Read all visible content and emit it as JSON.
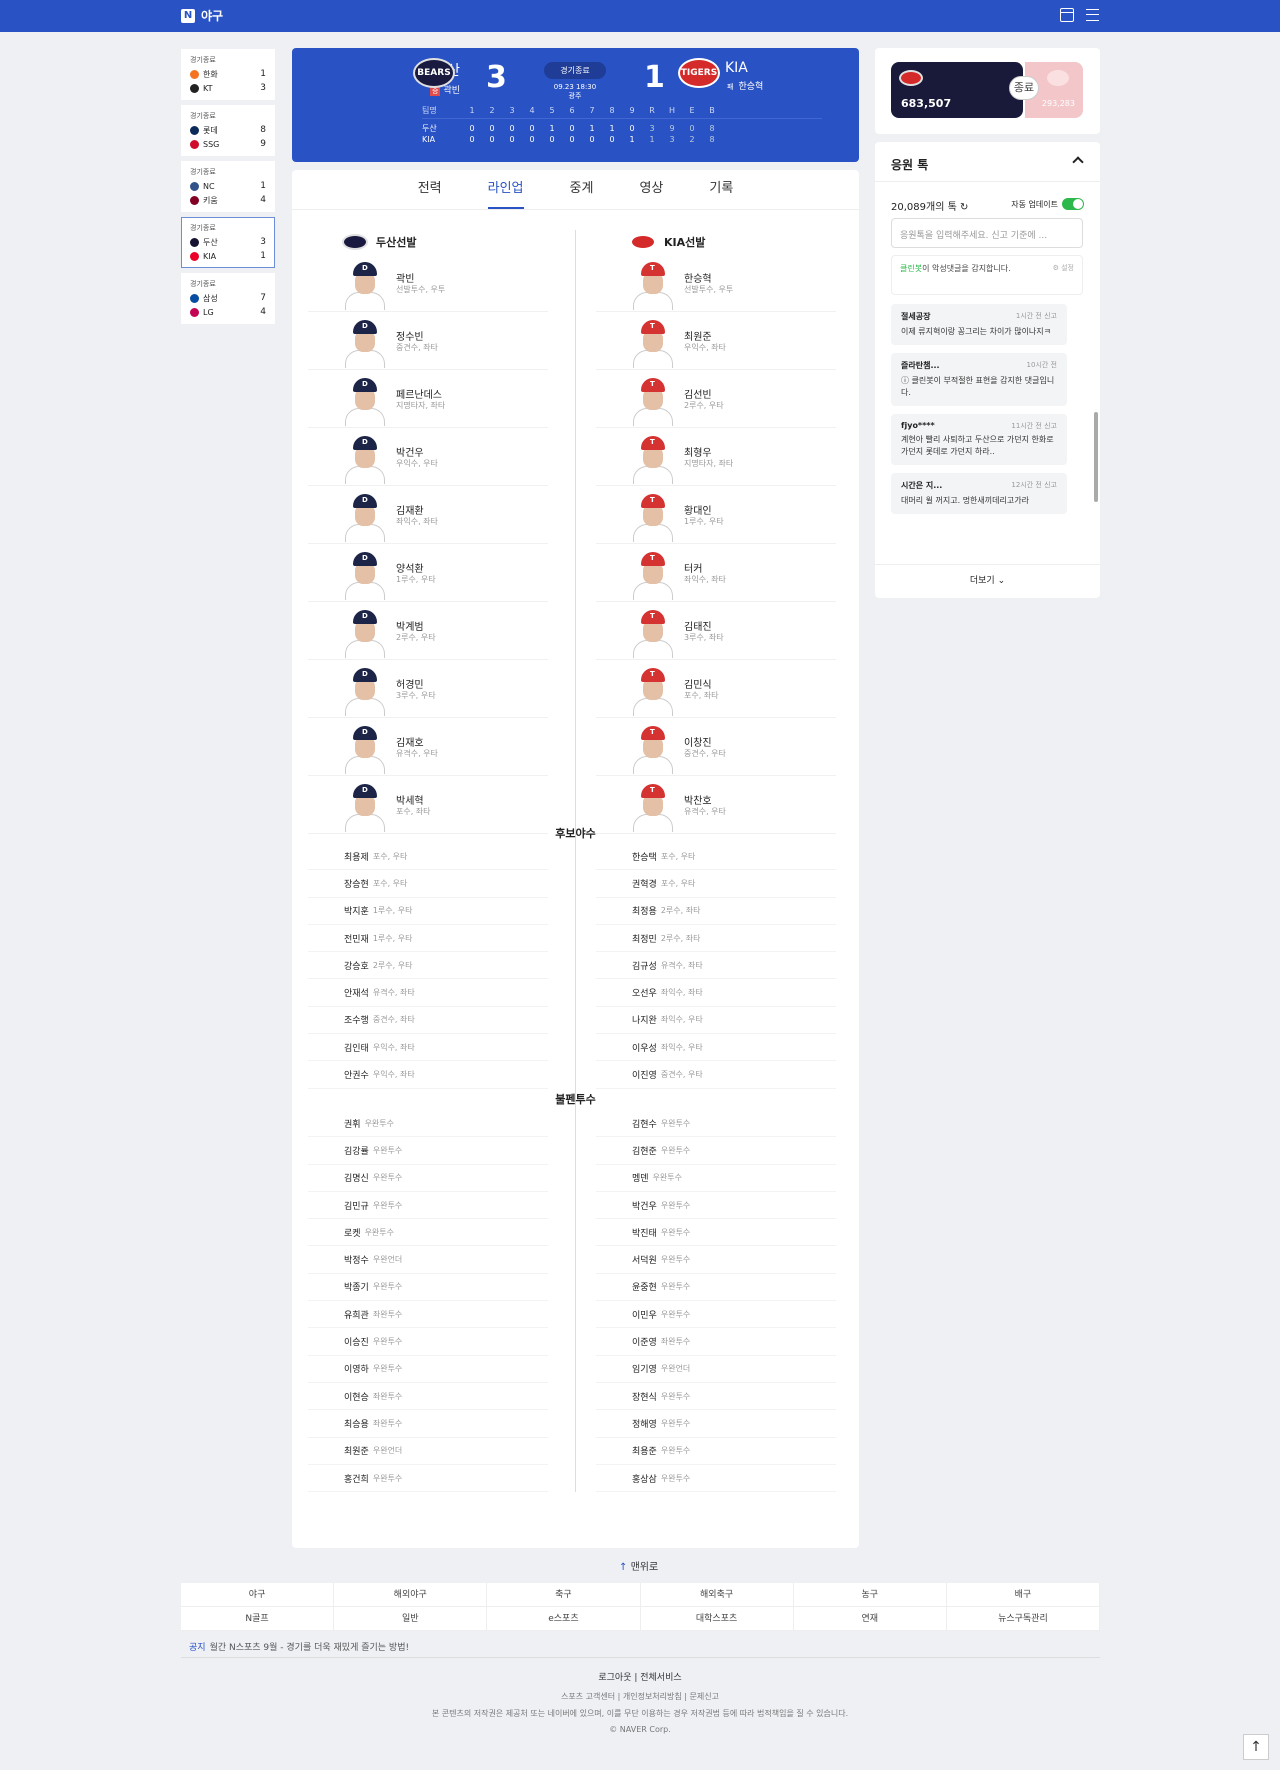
{
  "gnb": {
    "logo": "N",
    "service": "야구"
  },
  "games": [
    {
      "status": "경기종료",
      "t1": "한화",
      "s1": "1",
      "t2": "KT",
      "s2": "3",
      "c1": "#f37321",
      "c2": "#222"
    },
    {
      "status": "경기종료",
      "t1": "롯데",
      "s1": "8",
      "t2": "SSG",
      "s2": "9",
      "c1": "#0a2a5a",
      "c2": "#ce0e2d"
    },
    {
      "status": "경기종료",
      "t1": "NC",
      "s1": "1",
      "t2": "키움",
      "s2": "4",
      "c1": "#315288",
      "c2": "#820024"
    },
    {
      "status": "경기종료",
      "t1": "두산",
      "s1": "3",
      "t2": "KIA",
      "s2": "1",
      "c1": "#131230",
      "c2": "#ea0029"
    },
    {
      "status": "경기종료",
      "t1": "삼성",
      "s1": "7",
      "t2": "LG",
      "s2": "4",
      "c1": "#074ca1",
      "c2": "#c30452"
    }
  ],
  "scoreboard": {
    "away": {
      "name": "두산",
      "pitcher": "곽빈",
      "result": "승",
      "score": "3",
      "emblem": "BEARS"
    },
    "home": {
      "name": "KIA",
      "pitcher": "한승혁",
      "result": "패",
      "score": "1",
      "emblem": "TIGERS"
    },
    "status": "경기종료",
    "datetime": "09.23 18:30",
    "venue": "광주",
    "header": [
      "팀명",
      "1",
      "2",
      "3",
      "4",
      "5",
      "6",
      "7",
      "8",
      "9",
      "R",
      "H",
      "E",
      "B"
    ],
    "rows": [
      {
        "team": "두산",
        "vals": [
          "0",
          "0",
          "0",
          "0",
          "1",
          "0",
          "1",
          "1",
          "0",
          "3",
          "9",
          "0",
          "8"
        ]
      },
      {
        "team": "KIA",
        "vals": [
          "0",
          "0",
          "0",
          "0",
          "0",
          "0",
          "0",
          "0",
          "1",
          "1",
          "3",
          "2",
          "8"
        ]
      }
    ]
  },
  "tabs": [
    "전력",
    "라인업",
    "중계",
    "영상",
    "기록"
  ],
  "lineup": {
    "away_title": "두산선발",
    "home_title": "KIA선발",
    "away": [
      {
        "n": "곽빈",
        "p": "선발투수, 우투"
      },
      {
        "n": "정수빈",
        "p": "중견수, 좌타"
      },
      {
        "n": "페르난데스",
        "p": "지명타자, 좌타"
      },
      {
        "n": "박건우",
        "p": "우익수, 우타"
      },
      {
        "n": "김재환",
        "p": "좌익수, 좌타"
      },
      {
        "n": "양석환",
        "p": "1루수, 우타"
      },
      {
        "n": "박계범",
        "p": "2루수, 우타"
      },
      {
        "n": "허경민",
        "p": "3루수, 우타"
      },
      {
        "n": "김재호",
        "p": "유격수, 우타"
      },
      {
        "n": "박세혁",
        "p": "포수, 좌타"
      }
    ],
    "home": [
      {
        "n": "한승혁",
        "p": "선발투수, 우투"
      },
      {
        "n": "최원준",
        "p": "우익수, 좌타"
      },
      {
        "n": "김선빈",
        "p": "2루수, 우타"
      },
      {
        "n": "최형우",
        "p": "지명타자, 좌타"
      },
      {
        "n": "황대인",
        "p": "1루수, 우타"
      },
      {
        "n": "터커",
        "p": "좌익수, 좌타"
      },
      {
        "n": "김태진",
        "p": "3루수, 좌타"
      },
      {
        "n": "김민식",
        "p": "포수, 좌타"
      },
      {
        "n": "이창진",
        "p": "중견수, 우타"
      },
      {
        "n": "박찬호",
        "p": "유격수, 우타"
      }
    ],
    "bench_title": "후보야수",
    "bench_away": [
      {
        "n": "최용제",
        "p": "포수, 우타"
      },
      {
        "n": "장승현",
        "p": "포수, 우타"
      },
      {
        "n": "박지훈",
        "p": "1루수, 우타"
      },
      {
        "n": "전민재",
        "p": "1루수, 우타"
      },
      {
        "n": "강승호",
        "p": "2루수, 우타"
      },
      {
        "n": "안재석",
        "p": "유격수, 좌타"
      },
      {
        "n": "조수행",
        "p": "중견수, 좌타"
      },
      {
        "n": "김인태",
        "p": "우익수, 좌타"
      },
      {
        "n": "안권수",
        "p": "우익수, 좌타"
      }
    ],
    "bench_home": [
      {
        "n": "한승택",
        "p": "포수, 우타"
      },
      {
        "n": "권혁경",
        "p": "포수, 우타"
      },
      {
        "n": "최정용",
        "p": "2루수, 좌타"
      },
      {
        "n": "최정민",
        "p": "2루수, 좌타"
      },
      {
        "n": "김규성",
        "p": "유격수, 좌타"
      },
      {
        "n": "오선우",
        "p": "좌익수, 좌타"
      },
      {
        "n": "나지완",
        "p": "좌익수, 우타"
      },
      {
        "n": "이우성",
        "p": "좌익수, 우타"
      },
      {
        "n": "이진영",
        "p": "중견수, 우타"
      }
    ],
    "bullpen_title": "불펜투수",
    "bullpen_away": [
      {
        "n": "권휘",
        "p": "우완투수"
      },
      {
        "n": "김강률",
        "p": "우완투수"
      },
      {
        "n": "김명신",
        "p": "우완투수"
      },
      {
        "n": "김민규",
        "p": "우완투수"
      },
      {
        "n": "로켓",
        "p": "우완투수"
      },
      {
        "n": "박정수",
        "p": "우완언더"
      },
      {
        "n": "박종기",
        "p": "우완투수"
      },
      {
        "n": "유희관",
        "p": "좌완투수"
      },
      {
        "n": "이승진",
        "p": "우완투수"
      },
      {
        "n": "이영하",
        "p": "우완투수"
      },
      {
        "n": "이현승",
        "p": "좌완투수"
      },
      {
        "n": "최승용",
        "p": "좌완투수"
      },
      {
        "n": "최원준",
        "p": "우완언더"
      },
      {
        "n": "홍건희",
        "p": "우완투수"
      }
    ],
    "bullpen_home": [
      {
        "n": "김현수",
        "p": "우완투수"
      },
      {
        "n": "김현준",
        "p": "우완투수"
      },
      {
        "n": "멩덴",
        "p": "우완투수"
      },
      {
        "n": "박건우",
        "p": "우완투수"
      },
      {
        "n": "박진태",
        "p": "우완투수"
      },
      {
        "n": "서덕원",
        "p": "우완투수"
      },
      {
        "n": "윤중현",
        "p": "우완투수"
      },
      {
        "n": "이민우",
        "p": "우완투수"
      },
      {
        "n": "이준영",
        "p": "좌완투수"
      },
      {
        "n": "임기영",
        "p": "우완언더"
      },
      {
        "n": "장현식",
        "p": "우완투수"
      },
      {
        "n": "정해영",
        "p": "우완투수"
      },
      {
        "n": "최용준",
        "p": "우완투수"
      },
      {
        "n": "홍상삼",
        "p": "우완투수"
      }
    ]
  },
  "vote": {
    "away_count": "683,507",
    "home_count": "293,283",
    "end_label": "종료"
  },
  "cheer": {
    "title": "응원 톡",
    "count": "20,089개의 톡",
    "auto_label": "자동 업데이트",
    "placeholder": "응원톡을 입력해주세요. 신고 기준에 ...",
    "clean_bot": "클린봇",
    "clean_text": "이 악성댓글을 감지합니다.",
    "setting": "설정",
    "comments": [
      {
        "u": "절세공장",
        "t": "1시간 전",
        "r": "신고",
        "x": "이제 류지혁이랑 꽁그리는 차이가 많이나지ㅋ"
      },
      {
        "u": "즐라탄챔...",
        "t": "10시간 전",
        "r": "",
        "x": "ⓘ 클린봇이 부적절한 표현을 감지한 댓글입니다."
      },
      {
        "u": "fjyo****",
        "t": "11시간 전",
        "r": "신고",
        "x": "계현아 빨리 사퇴하고 두산으로 가던지 한화로 가던지 롯데로 가던지 하라.."
      },
      {
        "u": "시간은 지...",
        "t": "12시간 전",
        "r": "신고",
        "x": "대머리 윌 꺼지고. 멍한새끼데리고가라"
      }
    ],
    "more": "더보기"
  },
  "to_top": "맨위로",
  "footer_links": [
    "야구",
    "해외야구",
    "축구",
    "해외축구",
    "농구",
    "배구",
    "N골프",
    "일반",
    "e스포츠",
    "대학스포츠",
    "연재",
    "뉴스구독관리"
  ],
  "notice": {
    "label": "공지",
    "text": "월간 N스포츠 9월 - 경기를 더욱 재밌게 즐기는 방법!"
  },
  "bottom": {
    "l1": "로그아웃 | 전체서비스",
    "l2": "스포츠 고객센터 | 개인정보처리방침 | 문제신고",
    "l3": "본 콘텐츠의 저작권은 제공처 또는 네이버에 있으며, 이를 무단 이용하는 경우 저작권법 등에 따라 법적책임을 질 수 있습니다.",
    "l4": "© NAVER Corp."
  }
}
